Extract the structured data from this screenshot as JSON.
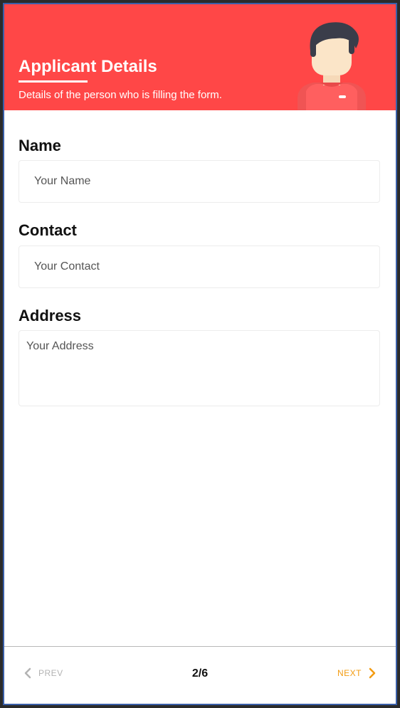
{
  "header": {
    "title": "Applicant Details",
    "subtitle": "Details of the person who is filling the form.",
    "background_color": "#ff4747"
  },
  "form": {
    "name": {
      "label": "Name",
      "placeholder": "Your Name",
      "value": ""
    },
    "contact": {
      "label": "Contact",
      "placeholder": "Your Contact",
      "value": ""
    },
    "address": {
      "label": "Address",
      "placeholder": "Your Address",
      "value": ""
    }
  },
  "footer": {
    "prev_label": "PREV",
    "page_indicator": "2/6",
    "next_label": "NEXT",
    "prev_icon": "chevron-left-icon",
    "next_icon": "chevron-right-icon",
    "next_color": "#f39c12",
    "prev_color": "#b3b3b3"
  }
}
